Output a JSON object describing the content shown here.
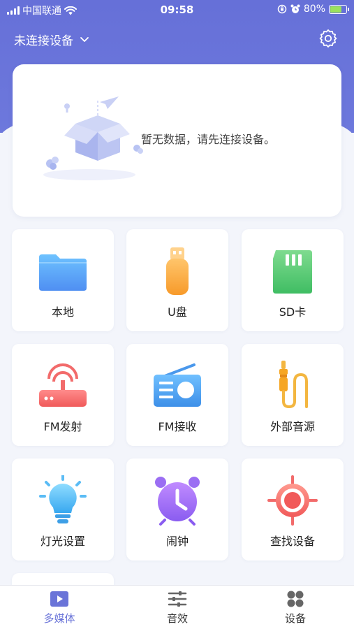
{
  "status_bar": {
    "carrier": "中国联通",
    "time": "09:58",
    "battery": "80%"
  },
  "header": {
    "device_label": "未连接设备"
  },
  "empty_state": {
    "message": "暂无数据，请先连接设备。"
  },
  "grid": {
    "items": [
      {
        "label": "本地",
        "icon": "folder-icon"
      },
      {
        "label": "U盘",
        "icon": "usb-drive-icon"
      },
      {
        "label": "SD卡",
        "icon": "sd-card-icon"
      },
      {
        "label": "FM发射",
        "icon": "fm-transmitter-icon"
      },
      {
        "label": "FM接收",
        "icon": "radio-icon"
      },
      {
        "label": "外部音源",
        "icon": "audio-jack-icon"
      },
      {
        "label": "灯光设置",
        "icon": "lightbulb-icon"
      },
      {
        "label": "闹钟",
        "icon": "alarm-clock-icon"
      },
      {
        "label": "查找设备",
        "icon": "locate-icon"
      }
    ]
  },
  "bottom_nav": {
    "items": [
      {
        "label": "多媒体",
        "icon": "play-video-icon",
        "active": true
      },
      {
        "label": "音效",
        "icon": "equalizer-icon",
        "active": false
      },
      {
        "label": "设备",
        "icon": "grid-apps-icon",
        "active": false
      }
    ]
  },
  "colors": {
    "primary": "#6a74d8",
    "background": "#f3f5fb",
    "battery_fill": "#9be15d"
  }
}
